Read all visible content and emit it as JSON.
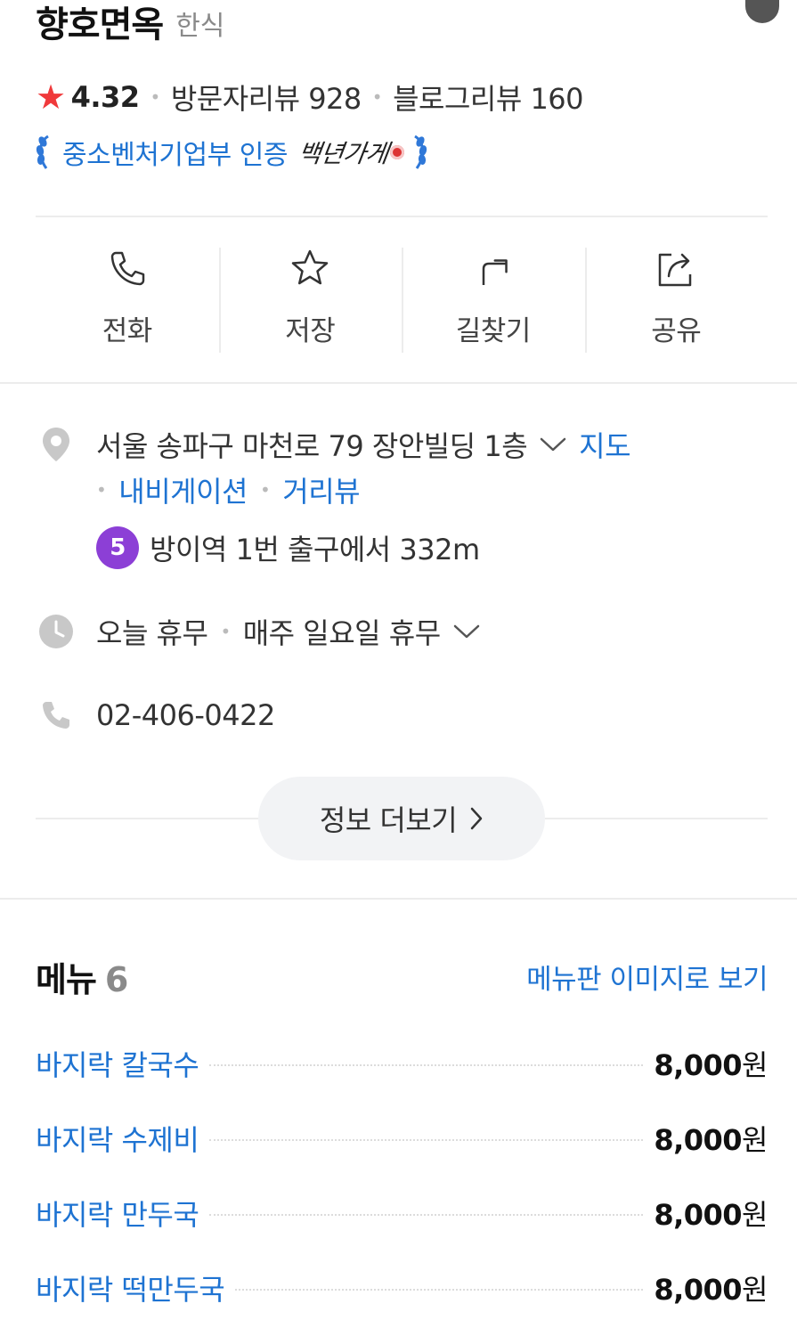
{
  "place": {
    "name": "향호면옥",
    "category": "한식"
  },
  "stats": {
    "rating": "4.32",
    "visitor_reviews": "방문자리뷰 928",
    "blog_reviews": "블로그리뷰 160"
  },
  "certification": {
    "text": "중소벤처기업부 인증",
    "script_text": "백년가게"
  },
  "actions": [
    {
      "label": "전화",
      "icon": "phone-icon"
    },
    {
      "label": "저장",
      "icon": "star-outline-icon"
    },
    {
      "label": "길찾기",
      "icon": "directions-icon"
    },
    {
      "label": "공유",
      "icon": "share-icon"
    }
  ],
  "info": {
    "address": "서울 송파구 마천로 79 장안빌딩 1층",
    "map_link": "지도",
    "nav_link": "내비게이션",
    "street_link": "거리뷰",
    "subway_line": "5",
    "subway_text": "방이역 1번 출구에서 332m",
    "hours_today": "오늘 휴무",
    "hours_detail": "매주 일요일 휴무",
    "phone": "02-406-0422",
    "more_button": "정보 더보기"
  },
  "menu": {
    "title": "메뉴",
    "count": "6",
    "image_link": "메뉴판 이미지로 보기",
    "items": [
      {
        "name": "바지락 칼국수",
        "price": "8,000",
        "unit": "원"
      },
      {
        "name": "바지락 수제비",
        "price": "8,000",
        "unit": "원"
      },
      {
        "name": "바지락 만두국",
        "price": "8,000",
        "unit": "원"
      },
      {
        "name": "바지락 떡만두국",
        "price": "8,000",
        "unit": "원"
      }
    ]
  },
  "colors": {
    "link": "#1e73d2",
    "star": "#f0393b",
    "subway_line_5": "#8c3fd6"
  }
}
